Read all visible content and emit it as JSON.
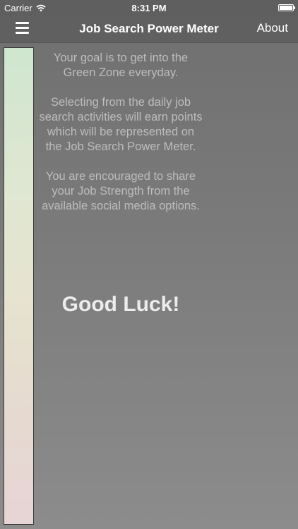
{
  "status_bar": {
    "carrier": "Carrier",
    "time": "8:31 PM",
    "wifi_icon": "wifi-icon",
    "battery_icon": "battery-icon"
  },
  "nav": {
    "menu_icon": "hamburger-menu-icon",
    "title": "Job Search Power Meter",
    "about_label": "About"
  },
  "power_meter": {
    "level": 0,
    "colors": {
      "top": "#cfe6cf",
      "bottom": "#e7d4d4"
    }
  },
  "content": {
    "paragraphs": [
      "Your goal is to get into the Green Zone everyday.",
      "Selecting from the daily job search activities will earn points which will be represented on the Job Search Power Meter.",
      "You are encouraged to share your Job Strength from the available social media options."
    ],
    "good_luck": "Good Luck!"
  },
  "colors": {
    "nav_background": "#606060",
    "body_text": "#bdbdbd",
    "heading_text": "#ececec"
  }
}
